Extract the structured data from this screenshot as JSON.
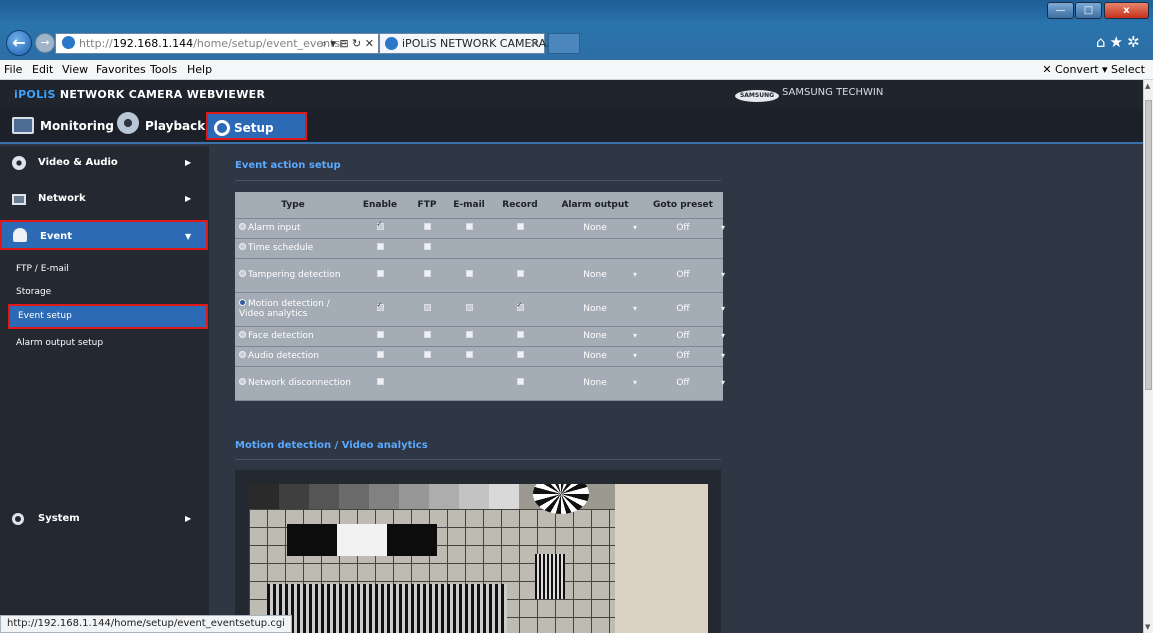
{
  "browser": {
    "address": {
      "protocol": "http://",
      "host": "192.168.1.144",
      "path": "/home/setup/event_eventse",
      "tools": "⌕ ▾ ⊟ ↻ ✕"
    },
    "tab_title": "iPOLiS NETWORK CAMERA...",
    "tab_close": "✕",
    "window_buttons": {
      "min": "—",
      "max": "□",
      "close": "x"
    },
    "icons": "⌂★✲"
  },
  "menu": {
    "items": [
      "File",
      "Edit",
      "View",
      "Favorites",
      "Tools",
      "Help"
    ],
    "right": "✕   Convert ▾   Select"
  },
  "app": {
    "brand_prefix": "iPOLiS",
    "brand_rest": " NETWORK CAMERA WEBVIEWER",
    "samsung_logo": "SAMSUNG",
    "samsung_text": "SAMSUNG TECHWIN",
    "tabs": {
      "monitoring": "Monitoring",
      "playback": "Playback",
      "setup": "Setup"
    }
  },
  "sidebar": {
    "video_audio": "Video & Audio",
    "network": "Network",
    "event": "Event",
    "system": "System",
    "sub_items": [
      "FTP / E-mail",
      "Storage",
      "Event setup",
      "Alarm output setup"
    ]
  },
  "main": {
    "section1_title": "Event action setup",
    "section2_title": "Motion detection / Video analytics",
    "table": {
      "headers": [
        "Type",
        "Enable",
        "FTP",
        "E-mail",
        "Record",
        "Alarm output",
        "Goto preset"
      ],
      "rows": [
        {
          "type": "Alarm input",
          "alarm": "None",
          "preset": "Off"
        },
        {
          "type": "Time schedule"
        },
        {
          "type": "Tampering detection",
          "alarm": "None",
          "preset": "Off"
        },
        {
          "type": "Motion detection / Video analytics",
          "alarm": "None",
          "preset": "Off"
        },
        {
          "type": "Face detection",
          "alarm": "None",
          "preset": "Off"
        },
        {
          "type": "Audio detection",
          "alarm": "None",
          "preset": "Off"
        },
        {
          "type": "Network disconnection",
          "alarm": "None",
          "preset": "Off"
        }
      ]
    }
  },
  "status": {
    "url": "http://192.168.1.144/home/setup/event_eventsetup.cgi"
  },
  "colors": {
    "accent": "#2d6ab5",
    "highlight_border": "#e01818",
    "section_title": "#5aa9ff",
    "background": "#2f3744"
  }
}
